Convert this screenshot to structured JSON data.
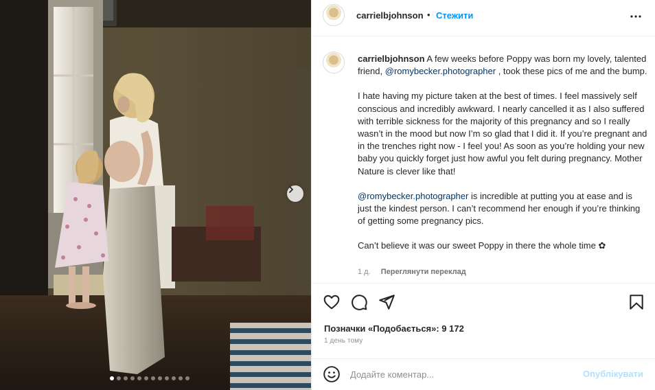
{
  "post": {
    "username": "carrielbjohnson",
    "dot": "•",
    "follow_label": "Стежити",
    "more_icon": "more-horizontal-icon"
  },
  "caption": {
    "username": "carrielbjohnson",
    "p1_before": " A few weeks before Poppy was born my lovely, talented friend, ",
    "p1_mention": "@romybecker.photographer",
    "p1_after": " , took these pics of me and the bump.",
    "p2": "I hate having my picture taken at the best of times. I feel massively self conscious and incredibly awkward. I nearly cancelled it as I also suffered with terrible sickness for the majority of this pregnancy and so I really wasn’t in the mood but now I’m so glad that I did it. If you’re pregnant and in the trenches right now - I feel you! As soon as you’re holding your new baby you quickly forget just how awful you felt during pregnancy. Mother Nature is clever like that!",
    "p3_mention": "@romybecker.photographer",
    "p3_after": " is incredible at putting you at ease and is just the kindest person. I can’t recommend her enough if you’re thinking of getting some pregnancy pics.",
    "p4": "Can’t believe it was our sweet Poppy in there the whole time ✿",
    "time": "1 д.",
    "translate_label": "Переглянути переклад"
  },
  "actions": {
    "icons": [
      "heart-icon",
      "comment-icon",
      "share-icon",
      "bookmark-icon"
    ],
    "likes": "Позначки «Подобається»: 9 172",
    "ago": "1 день тому"
  },
  "comment": {
    "placeholder": "Додайте коментар...",
    "post_label": "Опублікувати"
  },
  "carousel": {
    "slide_count": 12,
    "active_index": 0
  },
  "colors": {
    "accent": "#0095f6",
    "mention": "#00376b",
    "post_disabled": "#b2dffc",
    "muted": "#8e8e8e"
  }
}
